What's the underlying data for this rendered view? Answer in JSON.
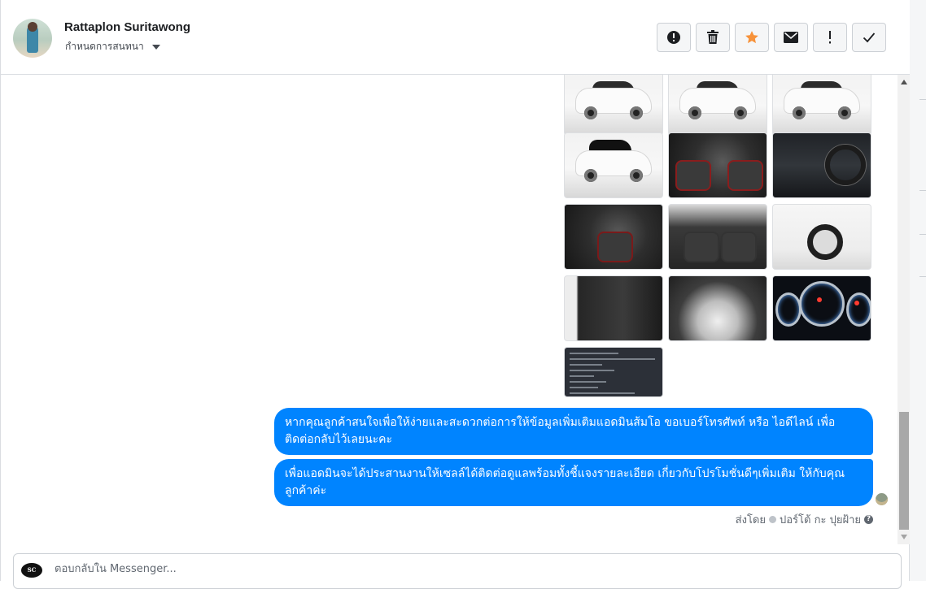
{
  "header": {
    "contact_name": "Rattaplon Suritawong",
    "assign_label": "กำหนดการสนทนา"
  },
  "toolbar": {
    "buttons": [
      {
        "name": "report-spam",
        "icon": "alert-circle-icon"
      },
      {
        "name": "delete",
        "icon": "trash-icon"
      },
      {
        "name": "star",
        "icon": "star-icon"
      },
      {
        "name": "mark-unread",
        "icon": "envelope-icon"
      },
      {
        "name": "mark-important",
        "icon": "exclamation-icon"
      },
      {
        "name": "mark-done",
        "icon": "check-icon"
      }
    ],
    "star_color": "#f7923a"
  },
  "conversation": {
    "photo_count": 13,
    "messages": [
      {
        "text": "หากคุณลูกค้าสนใจเพื่อให้ง่ายและสะดวกต่อการให้ข้อมูลเพิ่มเติมแอดมินส้มโอ ขอเบอร์โทรศัพท์ หรือ ไอดีไลน์ เพื่อติดต่อกลับไว้เลยนะคะ"
      },
      {
        "text": "เพื่อแอดมินจะได้ประสานงานให้เซลล์ได้ติดต่อดูแลพร้อมทั้งชี้แจงรายละเอียด เกี่ยวกับโปรโมชั่นดีๆเพิ่มเติม ให้กับคุณลูกค้าค่ะ"
      }
    ],
    "sent_by_label": "ส่งโดย",
    "sent_by_name": "ปอร์โต้ กะ ปุยฝ้าย",
    "bubble_color": "#0084ff"
  },
  "composer": {
    "placeholder": "ตอบกลับใน Messenger...",
    "logo_text": "SC"
  }
}
